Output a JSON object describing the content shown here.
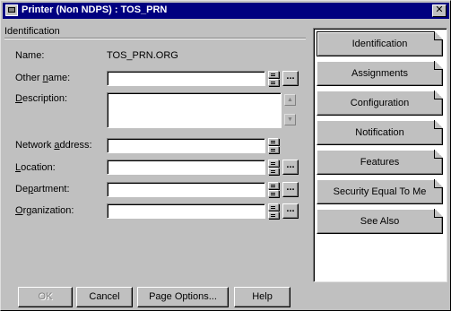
{
  "window": {
    "title": "Printer (Non NDPS) : TOS_PRN",
    "close_glyph": "✕"
  },
  "page": {
    "header": "Identification"
  },
  "form": {
    "name_label": "Name:",
    "name_value": "TOS_PRN.ORG",
    "other_name": {
      "pre": "Other ",
      "accel": "n",
      "post": "ame:",
      "value": ""
    },
    "description": {
      "pre": "",
      "accel": "D",
      "post": "escription:",
      "value": ""
    },
    "network_address": {
      "pre": "Network ",
      "accel": "a",
      "post": "ddress:",
      "value": ""
    },
    "location": {
      "pre": "",
      "accel": "L",
      "post": "ocation:",
      "value": ""
    },
    "department": {
      "pre": "De",
      "accel": "p",
      "post": "artment:",
      "value": ""
    },
    "organization": {
      "pre": "",
      "accel": "O",
      "post": "rganization:",
      "value": ""
    },
    "browse_label": "...",
    "scroll_up_glyph": "▲",
    "scroll_down_glyph": "▼"
  },
  "tabs": [
    {
      "label": "Identification",
      "active": true
    },
    {
      "label": "Assignments",
      "active": false
    },
    {
      "label": "Configuration",
      "active": false
    },
    {
      "label": "Notification",
      "active": false
    },
    {
      "label": "Features",
      "active": false
    },
    {
      "label": "Security Equal To Me",
      "active": false
    },
    {
      "label": "See Also",
      "active": false
    }
  ],
  "buttons": {
    "ok": "OK",
    "cancel": "Cancel",
    "page_options": "Page Options...",
    "help": "Help"
  },
  "colors": {
    "titlebar": "#000080",
    "face": "#c0c0c0"
  }
}
